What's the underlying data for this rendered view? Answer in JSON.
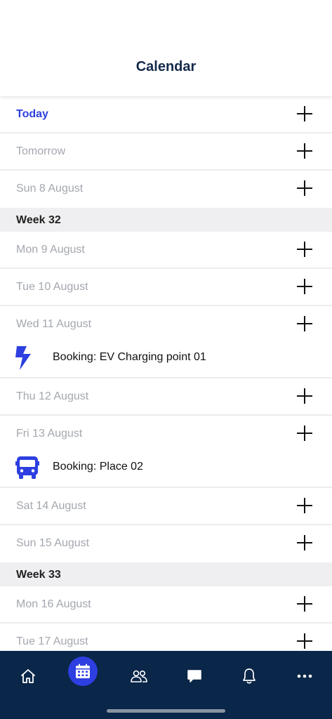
{
  "header": {
    "title": "Calendar"
  },
  "days_a": [
    {
      "label": "Today"
    },
    {
      "label": "Tomorrow"
    },
    {
      "label": "Sun 8 August"
    }
  ],
  "week32": {
    "label": "Week 32"
  },
  "days_b": [
    {
      "label": "Mon 9 August"
    },
    {
      "label": "Tue 10 August"
    },
    {
      "label": "Wed 11 August"
    }
  ],
  "booking1": {
    "label": "Booking: EV Charging point 01",
    "icon": "lightning-icon"
  },
  "days_c": [
    {
      "label": "Thu 12 August"
    },
    {
      "label": "Fri 13 August"
    }
  ],
  "booking2": {
    "label": "Booking: Place 02",
    "icon": "bus-icon"
  },
  "days_d": [
    {
      "label": "Sat 14 August"
    },
    {
      "label": "Sun 15 August"
    }
  ],
  "week33": {
    "label": "Week 33"
  },
  "days_e": [
    {
      "label": "Mon 16 August"
    },
    {
      "label": "Tue 17 August"
    }
  ],
  "tabbar": {
    "items": [
      "home-icon",
      "calendar-icon",
      "people-icon",
      "chat-icon",
      "bell-icon",
      "more-icon"
    ],
    "active": "calendar-icon"
  },
  "colors": {
    "accent": "#2d3fe0",
    "title": "#13294b",
    "tabbar_bg": "#0a2648",
    "day_text": "#a3a7ae"
  }
}
